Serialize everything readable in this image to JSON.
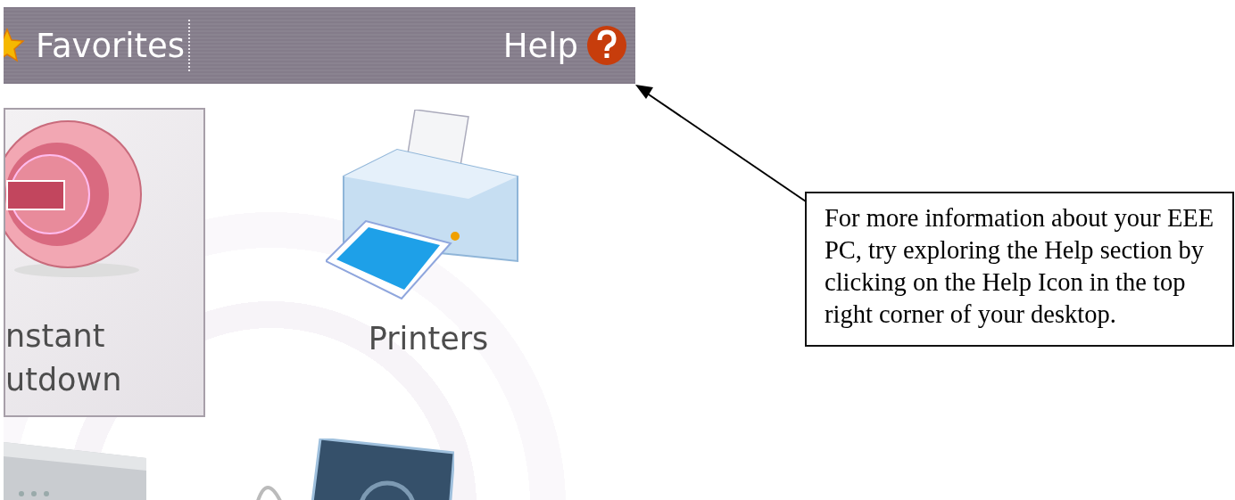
{
  "top_bar": {
    "favorites": "Favorites",
    "help": "Help"
  },
  "desktop_items": [
    {
      "kind": "shutdown",
      "label": "nstant\nutdown",
      "selected": true
    },
    {
      "kind": "printer",
      "label": "Printers",
      "selected": false
    }
  ],
  "callout": {
    "text": "For more information about your EEE PC, try exploring the Help section by clicking on the Help Icon in the top right corner of your desktop."
  }
}
